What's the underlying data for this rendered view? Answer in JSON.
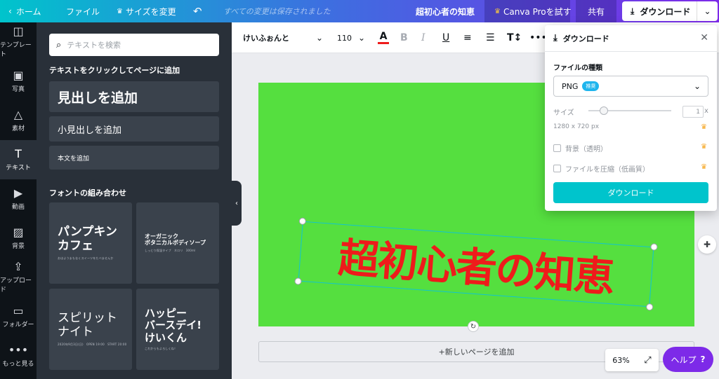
{
  "topbar": {
    "home": "ホーム",
    "file": "ファイル",
    "resize": "サイズを変更",
    "saved": "すべての変更は保存されました",
    "design_title": "超初心者の知恵",
    "try_pro": "Canva Proを試す",
    "share": "共有",
    "download": "ダウンロード"
  },
  "rail": [
    {
      "label": "テンプレート"
    },
    {
      "label": "写真"
    },
    {
      "label": "素材"
    },
    {
      "label": "テキスト"
    },
    {
      "label": "動画"
    },
    {
      "label": "背景"
    },
    {
      "label": "アップロード"
    },
    {
      "label": "フォルダー"
    },
    {
      "label": "もっと見る"
    }
  ],
  "panel": {
    "search_placeholder": "テキストを検索",
    "click_to_add": "テキストをクリックしてページに追加",
    "add_heading": "見出しを追加",
    "add_subheading": "小見出しを追加",
    "add_body": "本文を追加",
    "combos_title": "フォントの組み合わせ",
    "cards": [
      {
        "big": "パンプキン\nカフェ",
        "small": "おはようまもなくスイーツをたべませんか"
      },
      {
        "big": "オーガニック\nボタニカルボディソープ",
        "small": "しっとり保湿タイプ　ネロリ　300ml"
      },
      {
        "big": "スピリット\nナイト",
        "small": "2020年9月3日(日)　OPEN 19:00　START 20:00"
      },
      {
        "big": "ハッピー\nバースデイ!\nけいくん",
        "small": "これからもよろしくね！"
      }
    ]
  },
  "toolbar": {
    "font": "けいふぉんと",
    "size": "110"
  },
  "canvas": {
    "headline": "超初心者の知恵",
    "add_page": "+新しいページを追加",
    "artboard_color": "#55df3f",
    "headline_color": "#ee1b1b"
  },
  "zoom": {
    "level": "63%"
  },
  "help": {
    "label": "ヘルプ",
    "mark": "?"
  },
  "download_panel": {
    "title": "ダウンロード",
    "file_type_label": "ファイルの種類",
    "file_type": "PNG",
    "recommended": "推奨",
    "size_label": "サイズ",
    "size_value": "1",
    "size_unit": "x",
    "dimensions": "1280 x 720 px",
    "transparent_bg": "背景（透明）",
    "compress": "ファイルを圧縮（低画質）",
    "download_button": "ダウンロード"
  }
}
